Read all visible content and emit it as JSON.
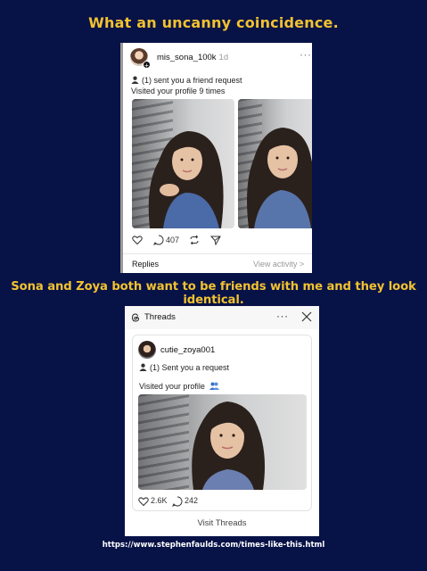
{
  "captions": {
    "top": "What an uncanny coincidence.",
    "middle": "Sona and Zoya both want to be friends with me  and they look identical.",
    "url": "https://www.stephenfaulds.com/times-like-this.html"
  },
  "post1": {
    "username": "mis_sona_100k",
    "time": "1d",
    "line1": "(1) sent you a friend request",
    "line2": "Visited your profile 9 times",
    "comment_count": "407",
    "replies_label": "Replies",
    "view_activity_label": "View activity >"
  },
  "post2": {
    "app_title": "Threads",
    "username": "cutie_zoya001",
    "line1": "(1) Sent you a request",
    "line2": "Visited your profile",
    "like_count": "2.6K",
    "comment_count": "242",
    "visit_label": "Visit Threads"
  },
  "colors": {
    "background": "#071247",
    "caption": "#f2c230"
  },
  "icons": [
    "plus-icon",
    "more-icon",
    "person-icon",
    "heart-icon",
    "comment-icon",
    "repost-icon",
    "share-icon",
    "threads-logo-icon",
    "close-icon",
    "people-emoji-icon"
  ]
}
